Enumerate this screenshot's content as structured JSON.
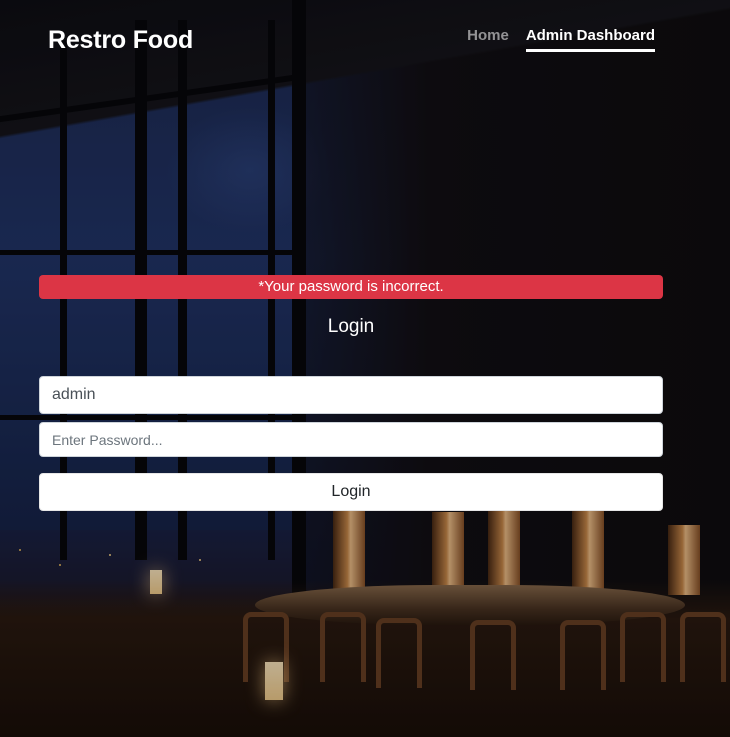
{
  "navbar": {
    "brand": "Restro Food",
    "links": [
      {
        "label": "Home",
        "active": false
      },
      {
        "label": "Admin Dashboard",
        "active": true
      }
    ]
  },
  "login": {
    "alert": "*Your password is incorrect.",
    "alert_color": "#dc3545",
    "title": "Login",
    "username_value": "admin",
    "password_placeholder": "Enter Password...",
    "submit_label": "Login"
  }
}
